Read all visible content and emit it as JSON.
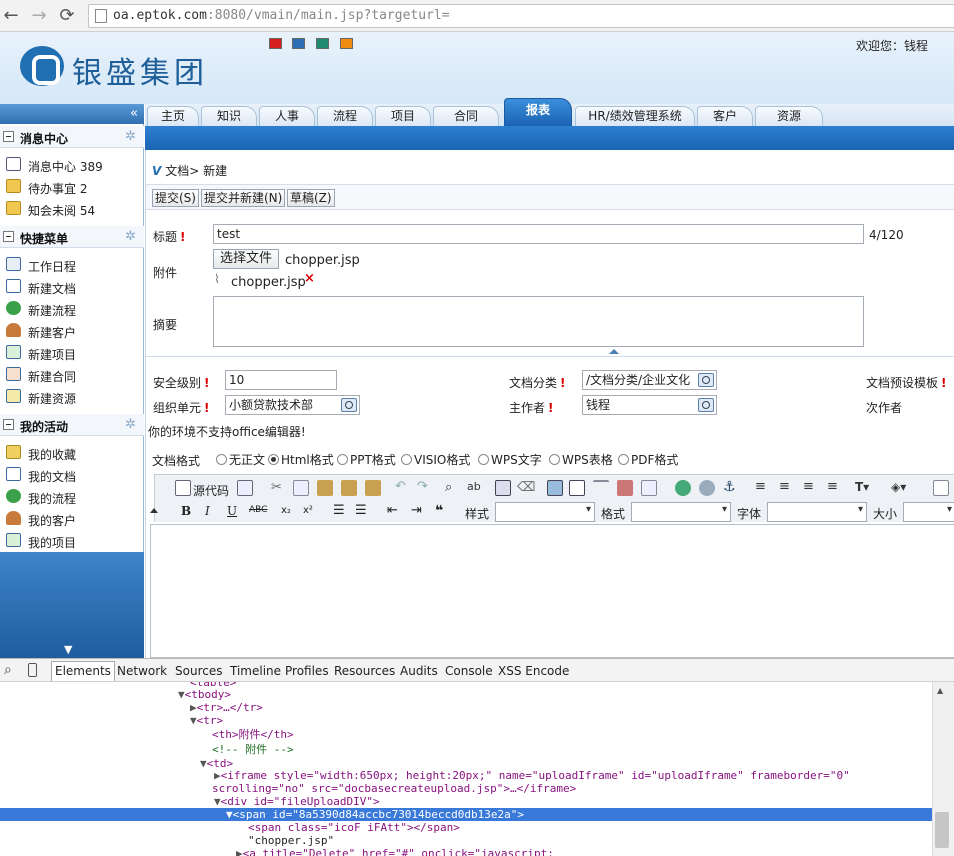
{
  "browser": {
    "url_host": "oa.eptok.com",
    "url_rest": ":8080/vmain/main.jsp?targeturl="
  },
  "header": {
    "company": "银盛集团",
    "welcome": "欢迎您：钱程",
    "skin_colors": [
      "#d62020",
      "#2c6fb2",
      "#1f8a70",
      "#f08c12"
    ]
  },
  "sidebar": {
    "sections": [
      {
        "title": "消息中心",
        "items": [
          {
            "label": "消息中心 389",
            "icon": "mail-icon"
          },
          {
            "label": "待办事宜 2",
            "icon": "todo-icon"
          },
          {
            "label": "知会未阅 54",
            "icon": "notify-icon"
          }
        ]
      },
      {
        "title": "快捷菜单",
        "items": [
          {
            "label": "工作日程",
            "icon": "calendar-icon"
          },
          {
            "label": "新建文档",
            "icon": "new-doc-icon"
          },
          {
            "label": "新建流程",
            "icon": "new-flow-icon"
          },
          {
            "label": "新建客户",
            "icon": "new-customer-icon"
          },
          {
            "label": "新建项目",
            "icon": "new-project-icon"
          },
          {
            "label": "新建合同",
            "icon": "new-contract-icon"
          },
          {
            "label": "新建资源",
            "icon": "new-resource-icon"
          }
        ]
      },
      {
        "title": "我的活动",
        "items": [
          {
            "label": "我的收藏",
            "icon": "favorites-icon"
          },
          {
            "label": "我的文档",
            "icon": "my-doc-icon"
          },
          {
            "label": "我的流程",
            "icon": "my-flow-icon"
          },
          {
            "label": "我的客户",
            "icon": "my-customer-icon"
          },
          {
            "label": "我的项目",
            "icon": "my-project-icon"
          }
        ]
      }
    ]
  },
  "tabs": [
    "主页",
    "知识",
    "人事",
    "流程",
    "项目",
    "合同",
    "报表",
    "HR/绩效管理系统",
    "客户",
    "资源"
  ],
  "active_tab": "报表",
  "breadcrumb": "文档> 新建",
  "toolbar": {
    "submit": "提交(S)",
    "submit_new": "提交并新建(N)",
    "draft": "草稿(Z)"
  },
  "form": {
    "title_label": "标题",
    "title_value": "test",
    "title_count": "4/120",
    "attach_label": "附件",
    "choose_file": "选择文件",
    "chosen_file": "chopper.jsp",
    "uploaded_file": "chopper.jsp",
    "summary_label": "摘要",
    "security_label": "安全级别",
    "security_value": "10",
    "category_label": "文档分类",
    "category_value": "/文档分类/企业文化",
    "template_label": "文档预设模板",
    "org_label": "组织单元",
    "org_value": "小额贷款技术部",
    "author_label": "主作者",
    "author_value": "钱程",
    "coauthor_label": "次作者",
    "office_notice": "你的环境不支持office编辑器!",
    "format_label": "文档格式",
    "formats": [
      "无正文",
      "Html格式",
      "PPT格式",
      "VISIO格式",
      "WPS文字",
      "WPS表格",
      "PDF格式"
    ],
    "selected_format": "Html格式"
  },
  "editor": {
    "source_label": "源代码",
    "style_label": "样式",
    "format_label": "格式",
    "font_label": "字体",
    "size_label": "大小"
  },
  "devtools": {
    "tabs": [
      "Elements",
      "Network",
      "Sources",
      "Timeline",
      "Profiles",
      "Resources",
      "Audits",
      "Console",
      "XSS Encode"
    ],
    "selected": "Elements",
    "lines": {
      "l0": "<tbody>",
      "l1": "<tr>…</tr>",
      "l2": "<tr>",
      "l3": "<th>附件</th>",
      "l4": "<!-- 附件 -->",
      "l5": "<td>",
      "l6a": "<iframe style=\"width:650px; height:20px;\" name=\"uploadIframe\" id=\"uploadIframe\" frameborder=\"0\"",
      "l6b": "scrolling=\"no\" src=\"docbasecreateupload.jsp\">…</iframe>",
      "l7": "<div id=\"fileUploadDIV\">",
      "l8": "<span id=\"8a5390d84accbc73014beccd0db13e2a\">",
      "l9": "<span class=\"icoF iFAtt\"></span>",
      "l10": "\"chopper.jsp\"",
      "l11": "<a title=\"Delete\" href=\"#\" onclick=\"javascript:"
    }
  }
}
